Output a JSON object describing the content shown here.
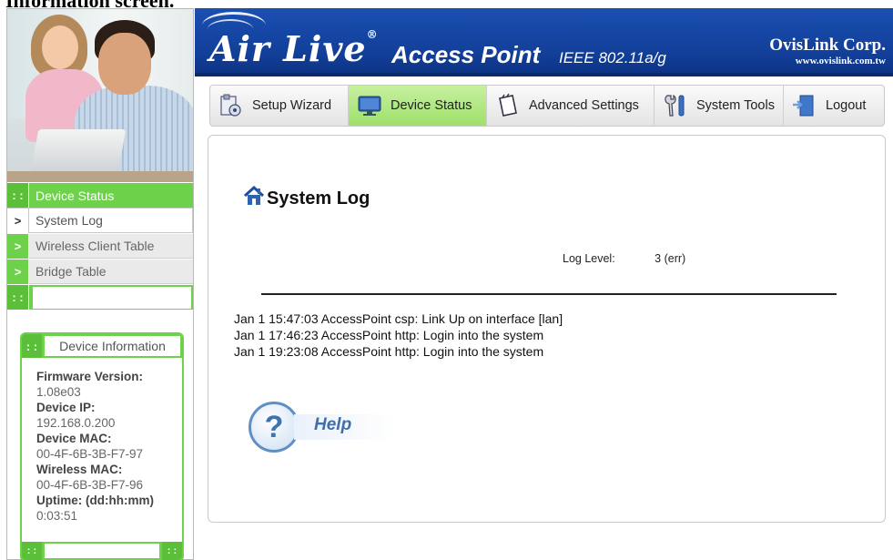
{
  "caption": "Information screen.",
  "banner": {
    "brand": "Air Live",
    "reg": "®",
    "product": "Access Point",
    "standard": "IEEE 802.11a/g",
    "corp": "OvisLink Corp.",
    "url": "www.ovislink.com.tw"
  },
  "topnav": {
    "tabs": [
      {
        "label": "Setup Wizard",
        "icon": "setup-wizard-icon"
      },
      {
        "label": "Device Status",
        "icon": "monitor-icon",
        "active": true
      },
      {
        "label": "Advanced Settings",
        "icon": "notepad-icon"
      },
      {
        "label": "System Tools",
        "icon": "wrench-icon"
      },
      {
        "label": "Logout",
        "icon": "door-icon"
      }
    ]
  },
  "sidebar": {
    "header": "Device Status",
    "items": [
      {
        "label": "System Log",
        "selected": true
      },
      {
        "label": "Wireless Client Table"
      },
      {
        "label": "Bridge Table"
      }
    ],
    "dots": ": :",
    "arrow": ">"
  },
  "device_info": {
    "title": "Device Information",
    "fields": [
      {
        "key": "Firmware Version:",
        "value": "1.08e03"
      },
      {
        "key": "Device IP:",
        "value": "192.168.0.200"
      },
      {
        "key": "Device MAC:",
        "value": "00-4F-6B-3B-F7-97"
      },
      {
        "key": "Wireless MAC:",
        "value": "00-4F-6B-3B-F7-96"
      },
      {
        "key": "Uptime: (dd:hh:mm)",
        "value": "0:03:51"
      }
    ]
  },
  "page": {
    "title": "System Log",
    "log_level_label": "Log Level:",
    "log_level_value": "3 (err)",
    "entries": [
      "Jan 1 15:47:03 AccessPoint csp: Link Up on interface [lan]",
      "Jan 1 17:46:23 AccessPoint http: Login into the system",
      "Jan 1 19:23:08 AccessPoint http: Login into the system"
    ],
    "help_label": "Help",
    "help_glyph": "?"
  },
  "colors": {
    "accent_green": "#6dd24a",
    "banner_blue": "#1a4fb2"
  }
}
